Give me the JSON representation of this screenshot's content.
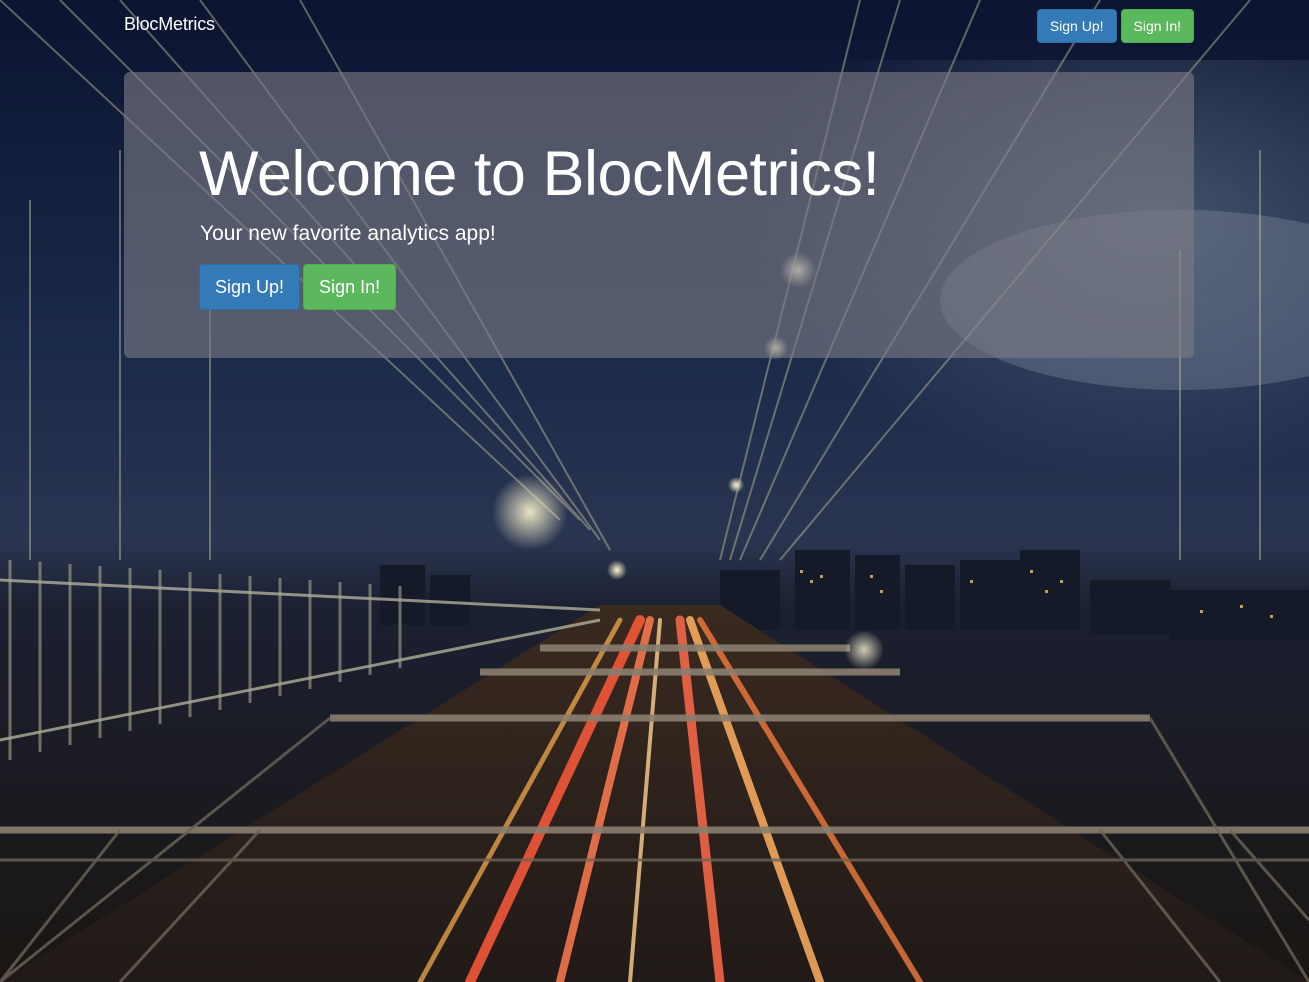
{
  "navbar": {
    "brand": "BlocMetrics",
    "signup_label": "Sign Up!",
    "signin_label": "Sign In!"
  },
  "jumbotron": {
    "title": "Welcome to BlocMetrics!",
    "lead": "Your new favorite analytics app!",
    "signup_label": "Sign Up!",
    "signin_label": "Sign In!"
  },
  "colors": {
    "primary": "#337ab7",
    "success": "#5cb85c",
    "jumbotron_overlay": "rgba(122,122,132,0.62)"
  }
}
